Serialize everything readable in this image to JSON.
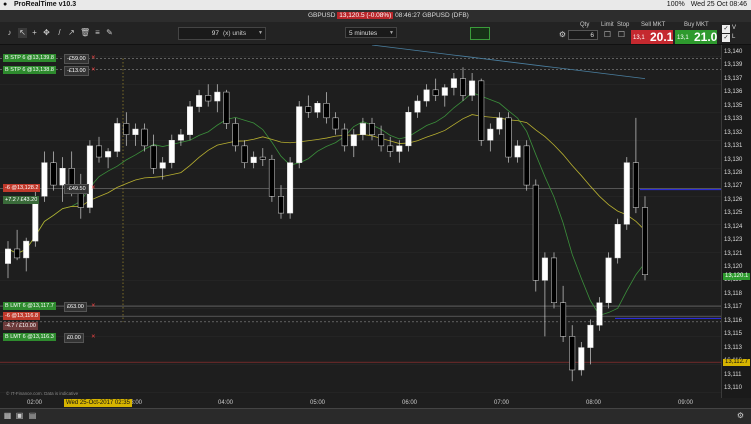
{
  "menubar": {
    "apple_icon": "apple-icon",
    "app_name": "ProRealTime v10.3",
    "status": [
      "100%",
      "Wed 25 Oct 08:46"
    ]
  },
  "titlebar": {
    "pair": "GBPUSD",
    "price": "13,120.5 (-0.08%)",
    "time": "08:46:27 GBPUSD (DFB)"
  },
  "toolbar": {
    "units_value": "97",
    "units_label": "(x) units",
    "interval": "5 minutes",
    "qty_label": "Qty",
    "qty_value": "6",
    "limit_label": "Limit",
    "stop_label": "Stop",
    "sell_label": "Sell MKT",
    "buy_label": "Buy MKT",
    "sell_small": "13,1",
    "sell_big": "20.1",
    "buy_small": "13,1",
    "buy_big": "21.0",
    "check_v": "V",
    "check_l": "L"
  },
  "orders": [
    {
      "label": "B STP 6 @13,139.8",
      "pnl": "-£59.00",
      "color": "#2e8b2e",
      "row": 0
    },
    {
      "label": "B STP 6 @13,138.8",
      "pnl": "-£13.00",
      "color": "#2e8b2e",
      "row": 1
    },
    {
      "label": "-6 @13,128.2",
      "pnl": "-£49.50",
      "color": "#c0392b",
      "row": 2
    },
    {
      "label": "+7.2 / £43.20",
      "pnl": "",
      "color": "#3a6b3a",
      "row": 3
    },
    {
      "label": "B LMT 6 @13,117.7",
      "pnl": "£63.00",
      "color": "#2e8b2e",
      "row": 4
    },
    {
      "label": "-6 @13,116.8",
      "pnl": "",
      "color": "#c0392b",
      "row": 5
    },
    {
      "label": "-4.7 / £10.00",
      "pnl": "",
      "color": "#6b3a3a",
      "row": 6
    },
    {
      "label": "B LMT 6 @13,116.3",
      "pnl": "£0.00",
      "color": "#2e8b2e",
      "row": 7
    }
  ],
  "price_axis": [
    "13,140",
    "13,139",
    "13,137",
    "13,136",
    "13,135",
    "13,133",
    "13,132",
    "13,131",
    "13,130",
    "13,128",
    "13,127",
    "13,126",
    "13,125",
    "13,124",
    "13,123",
    "13,121",
    "13,120",
    "13,119",
    "13,118",
    "13,117",
    "13,116",
    "13,115",
    "13,113",
    "13,112",
    "13,111",
    "13,110"
  ],
  "price_tags": {
    "current": "13,120.1",
    "level": "13,112.7"
  },
  "x_axis": [
    "02:00",
    "03:00",
    "04:00",
    "05:00",
    "06:00",
    "07:00",
    "08:00",
    "09:00"
  ],
  "date_highlight": "Wed 25-Oct-2017 02:35",
  "credit": "© IT-Finance.com. Data is indicative",
  "colors": {
    "bull": "#ffffff",
    "bear": "#000000",
    "ma_green": "#3b8f3b",
    "ma_yellow": "#b8b030",
    "ma_blue": "#4a7fa0",
    "hline_blue": "#2b2bd6",
    "hline_red": "#a03030"
  },
  "chart_data": {
    "type": "candlestick",
    "xlabel": "",
    "ylabel": "",
    "ylim": [
      13109.5,
      13141
    ],
    "candles": [
      [
        13121.5,
        13123.5,
        13120.2,
        13122.8
      ],
      [
        13122.8,
        13124.5,
        13121.8,
        13122.0
      ],
      [
        13122.0,
        13123.8,
        13120.8,
        13123.5
      ],
      [
        13123.5,
        13128.0,
        13123.0,
        13127.5
      ],
      [
        13127.5,
        13131.5,
        13127.0,
        13130.5
      ],
      [
        13130.5,
        13131.5,
        13128.0,
        13128.5
      ],
      [
        13128.5,
        13131.0,
        13127.0,
        13130.0
      ],
      [
        13130.0,
        13131.5,
        13127.5,
        13128.0
      ],
      [
        13128.0,
        13129.5,
        13125.5,
        13126.5
      ],
      [
        13126.5,
        13132.5,
        13126.0,
        13132.0
      ],
      [
        13132.0,
        13132.8,
        13130.5,
        13131.0
      ],
      [
        13131.0,
        13131.8,
        13130.0,
        13131.5
      ],
      [
        13131.5,
        13134.5,
        13131.0,
        13134.0
      ],
      [
        13134.0,
        13135.0,
        13132.0,
        13133.0
      ],
      [
        13133.0,
        13134.0,
        13132.0,
        13133.5
      ],
      [
        13133.5,
        13134.0,
        13131.5,
        13132.0
      ],
      [
        13132.0,
        13133.0,
        13129.5,
        13130.0
      ],
      [
        13130.0,
        13131.0,
        13129.0,
        13130.5
      ],
      [
        13130.5,
        13133.0,
        13130.0,
        13132.5
      ],
      [
        13132.5,
        13133.5,
        13132.0,
        13133.0
      ],
      [
        13133.0,
        13136.0,
        13132.5,
        13135.5
      ],
      [
        13135.5,
        13137.0,
        13135.0,
        13136.5
      ],
      [
        13136.5,
        13137.5,
        13135.5,
        13136.0
      ],
      [
        13136.0,
        13137.5,
        13135.0,
        13136.8
      ],
      [
        13136.8,
        13137.0,
        13133.5,
        13134.0
      ],
      [
        13134.0,
        13134.5,
        13131.5,
        13132.0
      ],
      [
        13132.0,
        13132.5,
        13130.0,
        13130.5
      ],
      [
        13130.5,
        13131.5,
        13130.0,
        13131.0
      ],
      [
        13131.0,
        13131.8,
        13130.2,
        13130.8
      ],
      [
        13130.8,
        13131.2,
        13127.0,
        13127.5
      ],
      [
        13127.5,
        13128.5,
        13125.5,
        13126.0
      ],
      [
        13126.0,
        13131.0,
        13125.5,
        13130.5
      ],
      [
        13130.5,
        13136.0,
        13130.0,
        13135.5
      ],
      [
        13135.5,
        13136.5,
        13134.5,
        13135.0
      ],
      [
        13135.0,
        13136.0,
        13134.5,
        13135.8
      ],
      [
        13135.8,
        13136.8,
        13134.0,
        13134.5
      ],
      [
        13134.5,
        13135.0,
        13133.0,
        13133.5
      ],
      [
        13133.5,
        13134.0,
        13131.5,
        13132.0
      ],
      [
        13132.0,
        13133.5,
        13131.0,
        13133.0
      ],
      [
        13133.0,
        13134.5,
        13132.5,
        13134.0
      ],
      [
        13134.0,
        13134.5,
        13132.5,
        13133.0
      ],
      [
        13133.0,
        13133.8,
        13131.5,
        13132.0
      ],
      [
        13132.0,
        13132.8,
        13131.0,
        13131.5
      ],
      [
        13131.5,
        13132.5,
        13130.5,
        13132.0
      ],
      [
        13132.0,
        13135.5,
        13131.5,
        13135.0
      ],
      [
        13135.0,
        13136.5,
        13134.5,
        13136.0
      ],
      [
        13136.0,
        13137.5,
        13135.5,
        13137.0
      ],
      [
        13137.0,
        13138.0,
        13136.0,
        13136.5
      ],
      [
        13136.5,
        13137.5,
        13135.5,
        13137.2
      ],
      [
        13137.2,
        13138.5,
        13136.5,
        13138.0
      ],
      [
        13138.0,
        13139.0,
        13136.0,
        13136.5
      ],
      [
        13136.5,
        13138.5,
        13136.0,
        13137.8
      ],
      [
        13137.8,
        13138.0,
        13132.0,
        13132.5
      ],
      [
        13132.5,
        13134.0,
        13131.5,
        13133.5
      ],
      [
        13133.5,
        13135.0,
        13133.0,
        13134.5
      ],
      [
        13134.5,
        13135.0,
        13130.5,
        13131.0
      ],
      [
        13131.0,
        13132.5,
        13130.5,
        13132.0
      ],
      [
        13132.0,
        13132.5,
        13128.0,
        13128.5
      ],
      [
        13128.5,
        13129.0,
        13119.0,
        13120.0
      ],
      [
        13120.0,
        13122.5,
        13115.0,
        13122.0
      ],
      [
        13122.0,
        13122.5,
        13117.5,
        13118.0
      ],
      [
        13118.0,
        13119.5,
        13114.5,
        13115.0
      ],
      [
        13115.0,
        13116.0,
        13111.0,
        13112.0
      ],
      [
        13112.0,
        13114.5,
        13111.5,
        13114.0
      ],
      [
        13114.0,
        13116.5,
        13112.5,
        13116.0
      ],
      [
        13116.0,
        13118.5,
        13115.5,
        13118.0
      ],
      [
        13118.0,
        13122.5,
        13117.5,
        13122.0
      ],
      [
        13122.0,
        13125.5,
        13121.5,
        13125.0
      ],
      [
        13125.0,
        13131.0,
        13124.5,
        13130.5
      ],
      [
        13130.5,
        13134.5,
        13126.0,
        13126.5
      ],
      [
        13126.5,
        13127.5,
        13120.0,
        13120.5
      ]
    ]
  }
}
